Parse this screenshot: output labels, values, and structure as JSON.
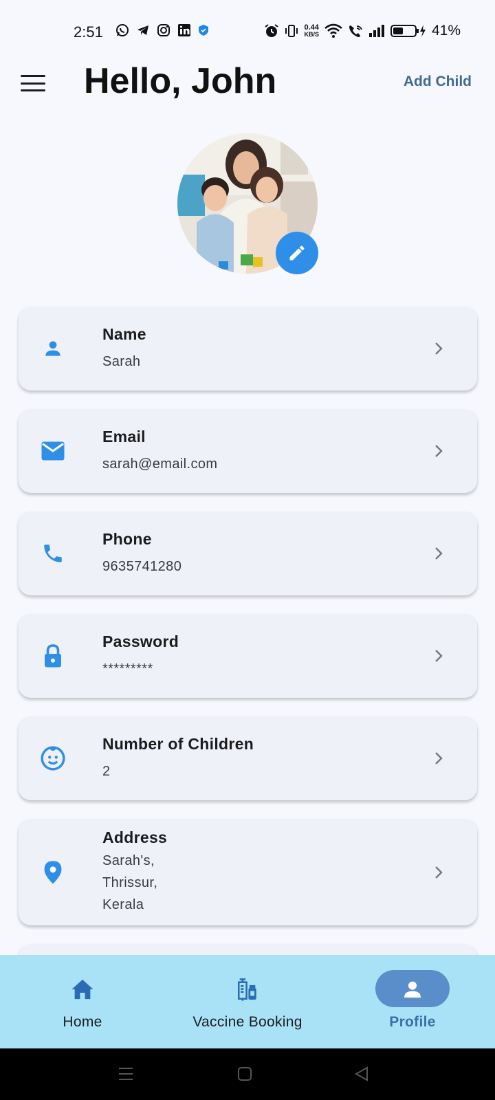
{
  "status_bar": {
    "time": "2:51",
    "network_speed_value": "0.44",
    "network_speed_unit": "KB/S",
    "battery_percent": "41%",
    "app_icons": [
      "whatsapp-icon",
      "telegram-icon",
      "instagram-icon",
      "linkedin-icon",
      "shield-icon"
    ],
    "system_icons": [
      "alarm-icon",
      "vibrate-icon",
      "wifi-icon",
      "wifi-calling-icon",
      "signal-icon",
      "battery-charging-icon"
    ]
  },
  "header": {
    "title": "Hello, John",
    "add_child_label": "Add Child"
  },
  "profile": {
    "fields": [
      {
        "id": "name",
        "icon": "person-icon",
        "label": "Name",
        "value": "Sarah"
      },
      {
        "id": "email",
        "icon": "email-icon",
        "label": "Email",
        "value": "sarah@email.com"
      },
      {
        "id": "phone",
        "icon": "phone-icon",
        "label": "Phone",
        "value": "9635741280"
      },
      {
        "id": "password",
        "icon": "lock-icon",
        "label": "Password",
        "value": "*********"
      },
      {
        "id": "children",
        "icon": "child-face-icon",
        "label": "Number of Children",
        "value": "2"
      },
      {
        "id": "address",
        "icon": "location-pin-icon",
        "label": "Address",
        "value_lines": [
          "Sarah's,",
          "Thrissur,",
          "Kerala"
        ]
      }
    ]
  },
  "bottom_nav": {
    "items": [
      {
        "label": "Home",
        "icon": "home-icon"
      },
      {
        "label": "Vaccine Booking",
        "icon": "vaccine-icon"
      },
      {
        "label": "Profile",
        "icon": "profile-icon",
        "active": true
      }
    ]
  },
  "colors": {
    "accent": "#2f8fe8",
    "nav_background": "#a9e2f6",
    "active_pill": "#5a8ecb",
    "link": "#3d6b94"
  }
}
